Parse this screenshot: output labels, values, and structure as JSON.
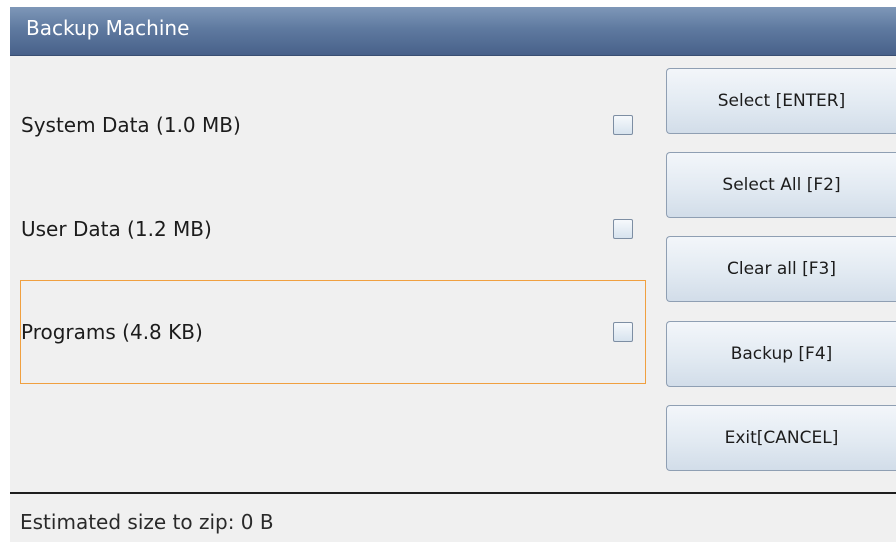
{
  "window": {
    "title": "Backup Machine"
  },
  "items": [
    {
      "label": "System Data (1.0 MB)",
      "checked": false
    },
    {
      "label": "User Data (1.2 MB)",
      "checked": false
    },
    {
      "label": "Programs (4.8 KB)",
      "checked": false,
      "focused": true
    }
  ],
  "buttons": {
    "select": "Select [ENTER]",
    "select_all": "Select All [F2]",
    "clear_all": "Clear all [F3]",
    "backup": "Backup [F4]",
    "exit": "Exit[CANCEL]"
  },
  "status": {
    "estimated_size": "Estimated size to zip: 0 B"
  },
  "colors": {
    "focus_border": "#f0a040",
    "titlebar": "#5f7aa0",
    "background": "#f0f0f0"
  }
}
